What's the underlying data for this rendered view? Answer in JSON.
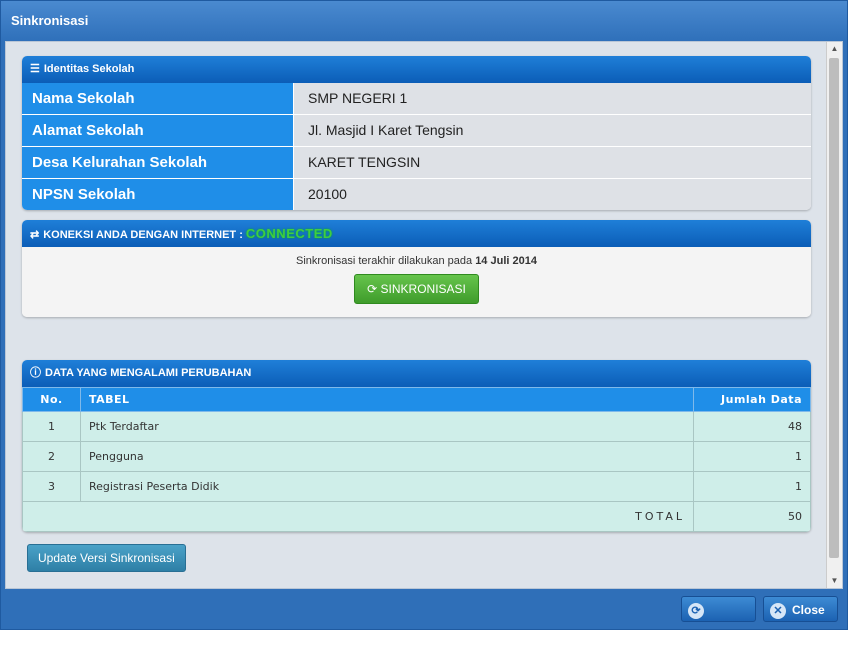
{
  "window": {
    "title": "Sinkronisasi"
  },
  "identitas": {
    "header": "Identitas Sekolah",
    "rows": [
      {
        "label": "Nama Sekolah",
        "value": "SMP NEGERI 1"
      },
      {
        "label": "Alamat Sekolah",
        "value": "Jl. Masjid I Karet Tengsin"
      },
      {
        "label": "Desa Kelurahan Sekolah",
        "value": "KARET TENGSIN"
      },
      {
        "label": "NPSN Sekolah",
        "value": "20100"
      }
    ]
  },
  "koneksi": {
    "header": "KONEKSI ANDA DENGAN INTERNET :",
    "status": "CONNECTED",
    "last_sync_text": "Sinkronisasi terakhir dilakukan pada",
    "last_sync_date": "14 Juli 2014",
    "sync_button": "SINKRONISASI"
  },
  "perubahan": {
    "header": "DATA YANG MENGALAMI PERUBAHAN",
    "columns": {
      "no": "No.",
      "tabel": "TABEL",
      "jumlah": "Jumlah Data"
    },
    "rows": [
      {
        "no": "1",
        "tabel": "Ptk Terdaftar",
        "jumlah": "48"
      },
      {
        "no": "2",
        "tabel": "Pengguna",
        "jumlah": "1"
      },
      {
        "no": "3",
        "tabel": "Registrasi Peserta Didik",
        "jumlah": "1"
      }
    ],
    "total_label": "TOTAL",
    "total_value": "50"
  },
  "update_button": "Update Versi Sinkronisasi",
  "footer": {
    "reload": "Reload",
    "close": "Close"
  },
  "colors": {
    "accent": "#1f8ee8",
    "connected": "#3fce3f",
    "sync_button": "#4fb03a"
  }
}
